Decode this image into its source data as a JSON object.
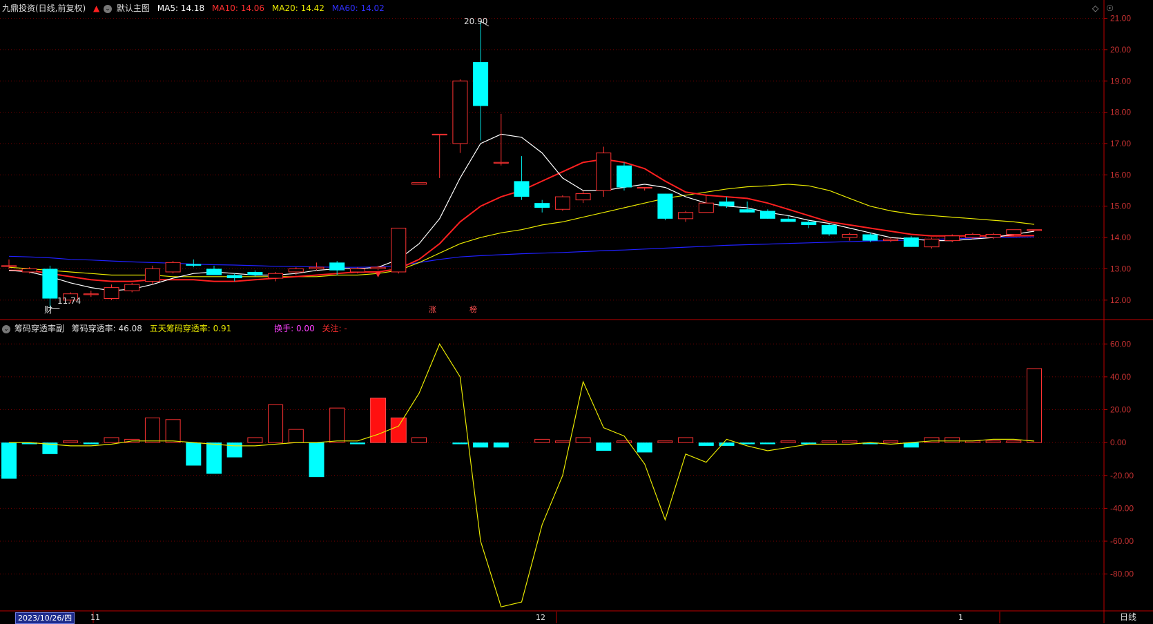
{
  "header": {
    "stock": "九鼎投资(日线,前复权)",
    "main_chart": "默认主图",
    "ma5": "MA5: 14.18",
    "ma10": "MA10: 14.06",
    "ma20": "MA20: 14.42",
    "ma60": "MA60: 14.02"
  },
  "sub_header": {
    "name": "筹码穿透率副",
    "rate": "筹码穿透率: 46.08",
    "five_day": "五天筹码穿透率: 0.91",
    "turnover": "换手: 0.00",
    "focus": "关注: -"
  },
  "colors": {
    "up": "#ff3232",
    "down": "#00ffff",
    "ma5": "#ffffff",
    "ma10": "#ff2020",
    "ma20": "#e8e800",
    "ma60": "#2020ff",
    "grid": "#7a0000",
    "axis": "#c00000"
  },
  "price_axis": {
    "min": 11.4,
    "max": 21.1,
    "ticks": [
      "21.00",
      "20.00",
      "19.00",
      "18.00",
      "17.00",
      "16.00",
      "15.00",
      "14.00",
      "13.00",
      "12.00"
    ]
  },
  "sub_axis": {
    "min": -102,
    "max": 66,
    "ticks": [
      "60.00",
      "40.00",
      "20.00",
      "0.00",
      "-20.00",
      "-40.00",
      "-60.00",
      "-80.00"
    ]
  },
  "annotations": {
    "high": "20.90",
    "low": "11.74",
    "cai": "财",
    "zhang": "涨",
    "bang": "榜"
  },
  "bottom": {
    "date": "2023/10/26/四",
    "period": "日线",
    "months": [
      "11",
      "12",
      "1"
    ]
  },
  "candles": [
    [
      13.1,
      13.0,
      13.1,
      13.3
    ],
    [
      12.9,
      12.85,
      13.0,
      13.05
    ],
    [
      13.0,
      11.75,
      12.05,
      13.1
    ],
    [
      12.0,
      11.9,
      12.2,
      12.25
    ],
    [
      12.2,
      12.1,
      12.2,
      12.3
    ],
    [
      12.05,
      12.0,
      12.4,
      12.5
    ],
    [
      12.3,
      12.25,
      12.5,
      12.55
    ],
    [
      12.6,
      12.5,
      13.0,
      13.1
    ],
    [
      12.9,
      12.85,
      13.2,
      13.25
    ],
    [
      13.15,
      13.05,
      13.1,
      13.3
    ],
    [
      13.0,
      12.85,
      12.8,
      13.1
    ],
    [
      12.8,
      12.6,
      12.7,
      12.85
    ],
    [
      12.9,
      12.75,
      12.8,
      12.95
    ],
    [
      12.7,
      12.6,
      12.85,
      12.9
    ],
    [
      12.9,
      12.8,
      13.0,
      13.05
    ],
    [
      13.0,
      12.95,
      13.05,
      13.2
    ],
    [
      13.2,
      12.8,
      12.95,
      13.25
    ],
    [
      12.9,
      12.85,
      13.0,
      13.05
    ],
    [
      13.0,
      12.95,
      13.05,
      13.1
    ],
    [
      12.9,
      12.85,
      14.3,
      14.3
    ],
    [
      15.7,
      15.7,
      15.75,
      15.75
    ],
    [
      17.3,
      15.9,
      17.3,
      17.3
    ],
    [
      17.0,
      16.7,
      19.0,
      19.05
    ],
    [
      19.6,
      17.1,
      18.2,
      20.9
    ],
    [
      16.4,
      16.3,
      16.4,
      17.95
    ],
    [
      15.8,
      15.2,
      15.3,
      16.6
    ],
    [
      15.1,
      14.8,
      14.95,
      15.2
    ],
    [
      14.9,
      14.85,
      15.3,
      15.35
    ],
    [
      15.2,
      15.1,
      15.4,
      15.5
    ],
    [
      15.5,
      15.3,
      16.7,
      16.9
    ],
    [
      16.3,
      15.5,
      15.6,
      16.4
    ],
    [
      15.6,
      15.5,
      15.6,
      15.6
    ],
    [
      15.4,
      14.55,
      14.6,
      15.4
    ],
    [
      14.6,
      14.5,
      14.8,
      14.85
    ],
    [
      14.8,
      14.8,
      15.1,
      15.35
    ],
    [
      15.15,
      14.95,
      15.0,
      15.3
    ],
    [
      14.9,
      14.8,
      14.8,
      15.15
    ],
    [
      14.85,
      14.6,
      14.6,
      14.9
    ],
    [
      14.6,
      14.5,
      14.5,
      14.7
    ],
    [
      14.5,
      14.3,
      14.4,
      14.55
    ],
    [
      14.4,
      14.05,
      14.1,
      14.45
    ],
    [
      14.0,
      13.9,
      14.1,
      14.15
    ],
    [
      14.1,
      13.85,
      13.9,
      14.15
    ],
    [
      13.9,
      13.85,
      13.95,
      14.0
    ],
    [
      14.0,
      13.7,
      13.7,
      14.05
    ],
    [
      13.7,
      13.65,
      13.95,
      14.0
    ],
    [
      13.9,
      13.85,
      14.05,
      14.1
    ],
    [
      14.0,
      13.95,
      14.1,
      14.15
    ],
    [
      14.0,
      13.95,
      14.1,
      14.15
    ],
    [
      14.1,
      14.05,
      14.25,
      14.25
    ],
    [
      14.25,
      14.2,
      14.25,
      14.25
    ]
  ],
  "ma5_series": [
    12.95,
    12.9,
    12.75,
    12.55,
    12.4,
    12.3,
    12.35,
    12.5,
    12.7,
    12.85,
    12.9,
    12.85,
    12.8,
    12.8,
    12.85,
    12.95,
    13.0,
    13.0,
    13.05,
    13.3,
    13.8,
    14.6,
    15.9,
    17.0,
    17.3,
    17.2,
    16.7,
    15.9,
    15.5,
    15.5,
    15.6,
    15.7,
    15.6,
    15.3,
    15.1,
    15.0,
    14.95,
    14.8,
    14.7,
    14.55,
    14.45,
    14.3,
    14.15,
    14.0,
    13.95,
    13.9,
    13.9,
    13.95,
    14.0,
    14.1,
    14.2
  ],
  "ma10_series": [
    12.95,
    12.95,
    12.85,
    12.75,
    12.65,
    12.6,
    12.6,
    12.65,
    12.65,
    12.65,
    12.6,
    12.6,
    12.65,
    12.7,
    12.75,
    12.8,
    12.85,
    12.9,
    12.9,
    13.0,
    13.3,
    13.8,
    14.5,
    15.0,
    15.3,
    15.5,
    15.8,
    16.1,
    16.4,
    16.5,
    16.4,
    16.2,
    15.8,
    15.45,
    15.35,
    15.3,
    15.25,
    15.1,
    14.9,
    14.7,
    14.5,
    14.4,
    14.3,
    14.2,
    14.1,
    14.05,
    14.05,
    14.05,
    14.05,
    14.05,
    14.06
  ],
  "ma20_series": [
    13.05,
    13.0,
    12.95,
    12.9,
    12.85,
    12.8,
    12.8,
    12.8,
    12.75,
    12.75,
    12.75,
    12.75,
    12.75,
    12.75,
    12.75,
    12.75,
    12.8,
    12.8,
    12.85,
    12.95,
    13.2,
    13.5,
    13.8,
    14.0,
    14.15,
    14.25,
    14.4,
    14.5,
    14.65,
    14.8,
    14.95,
    15.1,
    15.25,
    15.35,
    15.45,
    15.55,
    15.62,
    15.65,
    15.7,
    15.65,
    15.5,
    15.25,
    15.0,
    14.85,
    14.75,
    14.7,
    14.65,
    14.6,
    14.55,
    14.5,
    14.42
  ],
  "ma60_series": [
    13.4,
    13.38,
    13.35,
    13.3,
    13.28,
    13.25,
    13.22,
    13.2,
    13.18,
    13.15,
    13.13,
    13.12,
    13.1,
    13.08,
    13.07,
    13.06,
    13.05,
    13.05,
    13.06,
    13.1,
    13.2,
    13.3,
    13.38,
    13.42,
    13.45,
    13.48,
    13.5,
    13.52,
    13.55,
    13.58,
    13.6,
    13.63,
    13.66,
    13.69,
    13.72,
    13.75,
    13.77,
    13.79,
    13.81,
    13.83,
    13.85,
    13.87,
    13.89,
    13.9,
    13.92,
    13.94,
    13.96,
    13.98,
    14.0,
    14.01,
    14.02
  ],
  "bars": [
    -22,
    -1,
    -7,
    1,
    -1,
    3,
    2,
    15,
    14,
    -14,
    -19,
    -9,
    3,
    23,
    8,
    -21,
    21,
    -1,
    27,
    15,
    3,
    0,
    -1,
    -3,
    -3,
    0,
    2,
    1,
    3,
    -5,
    1,
    -6,
    1,
    3,
    -2,
    -2,
    -1,
    -1,
    1,
    -1,
    1,
    1,
    -1,
    1,
    -3,
    3,
    3,
    1,
    1,
    1,
    45
  ],
  "bar_highlight": [
    18,
    19
  ],
  "line5": [
    0,
    0,
    -1,
    -2,
    -2,
    -1,
    1,
    1,
    1,
    0,
    -1,
    -2,
    -2,
    -1,
    0,
    0,
    1,
    1,
    5,
    10,
    30,
    60,
    40,
    -60,
    -100,
    -97,
    -50,
    -20,
    37,
    9,
    4,
    -13,
    -47,
    -7,
    -12,
    2,
    -2,
    -5,
    -3,
    -1,
    -1,
    -1,
    0,
    -1,
    0,
    1,
    1,
    1,
    2,
    2,
    0.91
  ]
}
